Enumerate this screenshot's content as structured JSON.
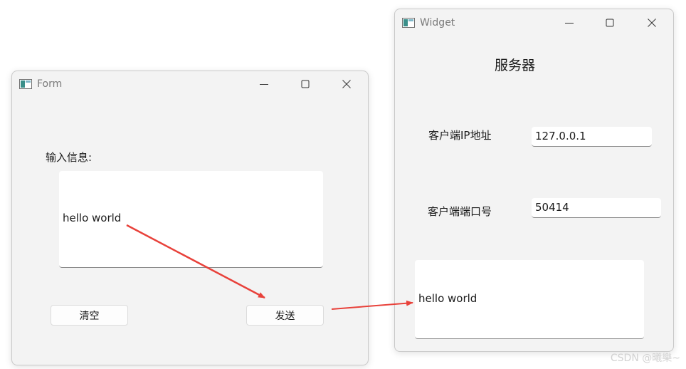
{
  "form_window": {
    "title": "Form",
    "input_label": "输入信息:",
    "message_text": "hello world",
    "clear_button": "清空",
    "send_button": "发送"
  },
  "widget_window": {
    "title": "Widget",
    "heading": "服务器",
    "client_ip_label": "客户端IP地址",
    "client_ip_value": "127.0.0.1",
    "client_port_label": "客户端端口号",
    "client_port_value": "50414",
    "received_text": "hello world"
  },
  "watermark": "CSDN @曦樂~",
  "colors": {
    "arrow": "#e8413a",
    "window_bg": "#f3f3f3",
    "textbox_bg": "#ffffff"
  },
  "icons": {
    "app": "app-window-icon",
    "minimize": "minimize-icon",
    "maximize": "maximize-icon",
    "close": "close-icon"
  }
}
